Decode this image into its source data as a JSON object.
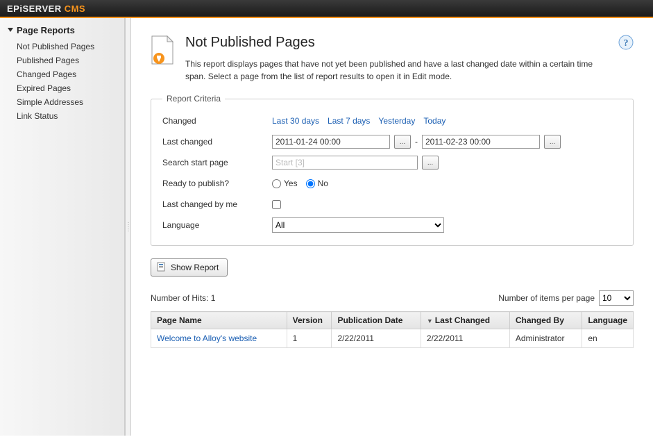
{
  "brand": {
    "part1": "EPiSERVER",
    "part2": "CMS"
  },
  "sidebar": {
    "heading": "Page Reports",
    "items": [
      {
        "label": "Not Published Pages"
      },
      {
        "label": "Published Pages"
      },
      {
        "label": "Changed Pages"
      },
      {
        "label": "Expired Pages"
      },
      {
        "label": "Simple Addresses"
      },
      {
        "label": "Link Status"
      }
    ]
  },
  "page": {
    "title": "Not Published Pages",
    "description": "This report displays pages that have not yet been published and have a last changed date within a certain time span. Select a page from the list of report results to open it in Edit mode."
  },
  "criteria": {
    "legend": "Report Criteria",
    "changed_label": "Changed",
    "presets": [
      "Last 30 days",
      "Last 7 days",
      "Yesterday",
      "Today"
    ],
    "last_changed_label": "Last changed",
    "from_value": "2011-01-24 00:00",
    "to_value": "2011-02-23 00:00",
    "range_sep": "-",
    "search_start_label": "Search start page",
    "search_start_placeholder": "Start [3]",
    "ready_label": "Ready to publish?",
    "ready_yes": "Yes",
    "ready_no": "No",
    "ready_selected": "No",
    "changed_by_me_label": "Last changed by me",
    "language_label": "Language",
    "language_value": "All"
  },
  "actions": {
    "show_report": "Show Report"
  },
  "results": {
    "hits_label_prefix": "Number of Hits: ",
    "hits_count": "1",
    "per_page_label": "Number of items per page",
    "per_page_value": "10",
    "columns": {
      "page_name": "Page Name",
      "version": "Version",
      "publication_date": "Publication Date",
      "last_changed": "Last Changed",
      "changed_by": "Changed By",
      "language": "Language"
    },
    "rows": [
      {
        "page_name": "Welcome to Alloy's website",
        "version": "1",
        "publication_date": "2/22/2011",
        "last_changed": "2/22/2011",
        "changed_by": "Administrator",
        "language": "en"
      }
    ]
  }
}
